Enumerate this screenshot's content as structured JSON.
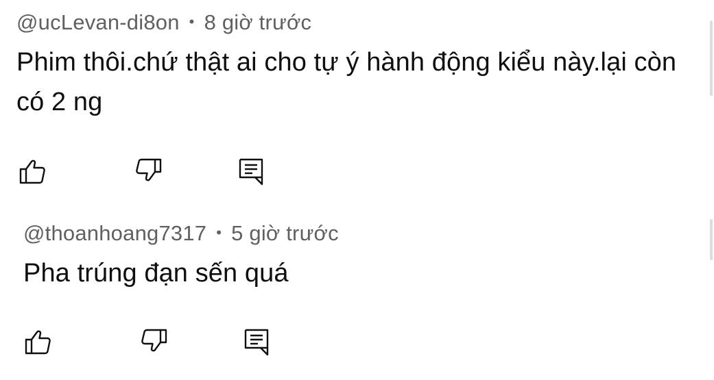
{
  "comments": [
    {
      "author": "@ucLevan-di8on",
      "separator": "•",
      "time": "8 giờ trước",
      "text": "Phim thôi.chứ thật ai cho tự ý hành động kiểu này.lại còn có 2 ng",
      "actions": {
        "like_icon": "thumbs-up-icon",
        "dislike_icon": "thumbs-down-icon",
        "reply_icon": "reply-comment-icon"
      }
    },
    {
      "author": "@thoanhoang7317",
      "separator": "•",
      "time": "5 giờ trước",
      "text": "Pha trúng đạn sến quá",
      "actions": {
        "like_icon": "thumbs-up-icon",
        "dislike_icon": "thumbs-down-icon",
        "reply_icon": "reply-comment-icon"
      }
    }
  ],
  "colors": {
    "meta_text": "#606060",
    "body_text": "#0f0f0f",
    "icon_stroke": "#0f0f0f",
    "background": "#ffffff"
  }
}
